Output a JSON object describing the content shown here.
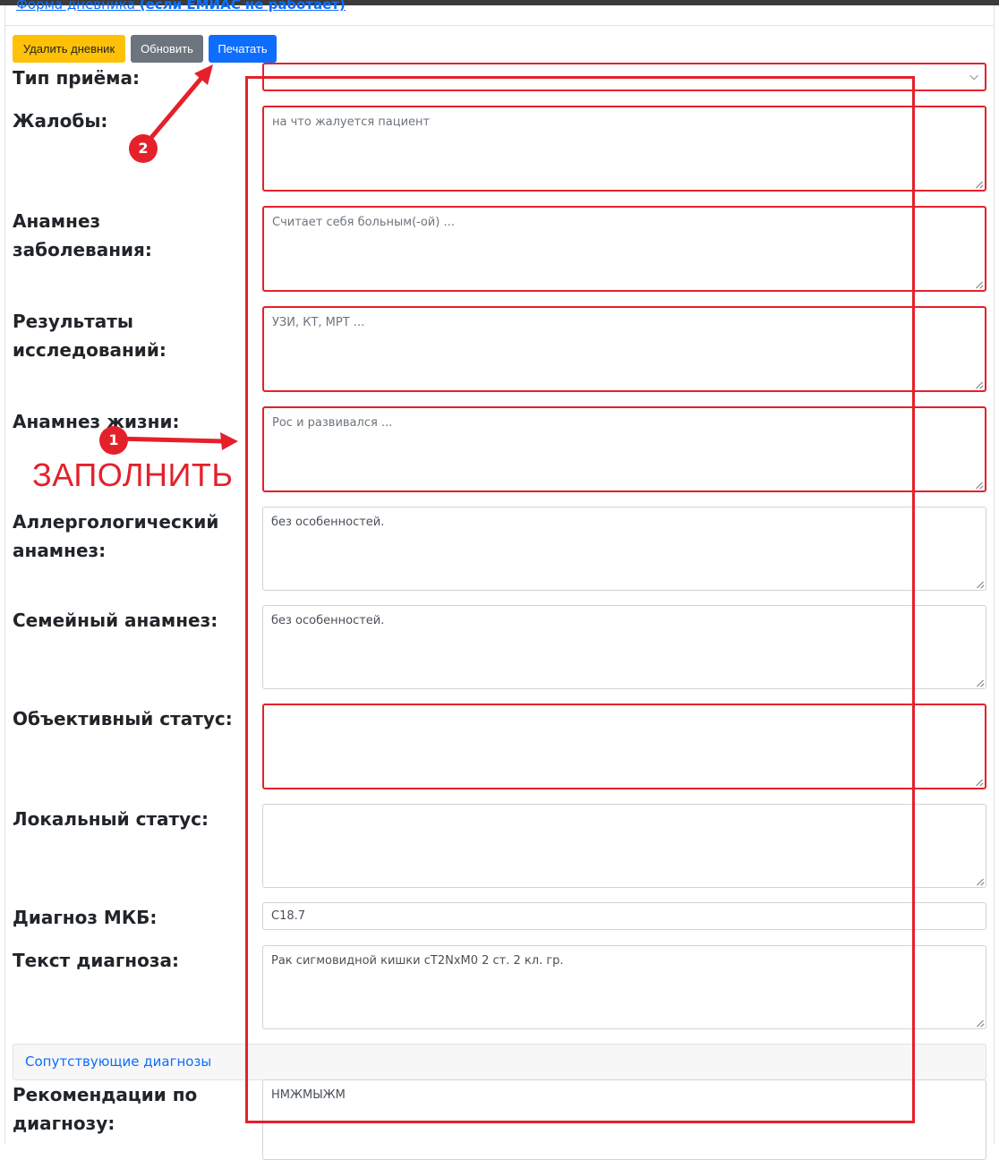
{
  "header": {
    "link_text": "Форма дневника ",
    "link_bold": "(если ЕМИАС не работает)"
  },
  "toolbar": {
    "delete_label": "Удалить дневник",
    "refresh_label": "Обновить",
    "print_label": "Печатать"
  },
  "form": {
    "visit_type": {
      "label": "Тип приёма:",
      "value": ""
    },
    "complaints": {
      "label": "Жалобы:",
      "placeholder": "на что жалуется пациент",
      "value": ""
    },
    "disease_history": {
      "label": "Анамнез заболевания:",
      "placeholder": "Считает себя больным(-ой) ...",
      "value": ""
    },
    "research_results": {
      "label": "Результаты исследований:",
      "placeholder": "УЗИ, КТ, МРТ ...",
      "value": ""
    },
    "life_history": {
      "label": "Анамнез жизни:",
      "placeholder": "Рос и развивался ...",
      "value": ""
    },
    "allergy_history": {
      "label": "Аллергологический анамнез:",
      "value": "без особенностей."
    },
    "family_history": {
      "label": "Семейный анамнез:",
      "value": "без особенностей."
    },
    "objective_status": {
      "label": "Объективный статус:",
      "value": ""
    },
    "local_status": {
      "label": "Локальный статус:",
      "value": ""
    },
    "icd_diagnosis": {
      "label": "Диагноз МКБ:",
      "value": "C18.7"
    },
    "diagnosis_text": {
      "label": "Текст диагноза:",
      "value": "Рак сигмовидной кишки cT2NxM0 2 ст. 2 кл. гр."
    },
    "concomitant_label": "Сопутствующие диагнозы",
    "recommendations": {
      "label": "Рекомендации по диагнозу:",
      "value": "НМЖМЫЖМ"
    }
  },
  "annotations": {
    "fill_text": "ЗАПОЛНИТЬ",
    "badge_1": "1",
    "badge_2": "2",
    "color": "#e4212b"
  }
}
